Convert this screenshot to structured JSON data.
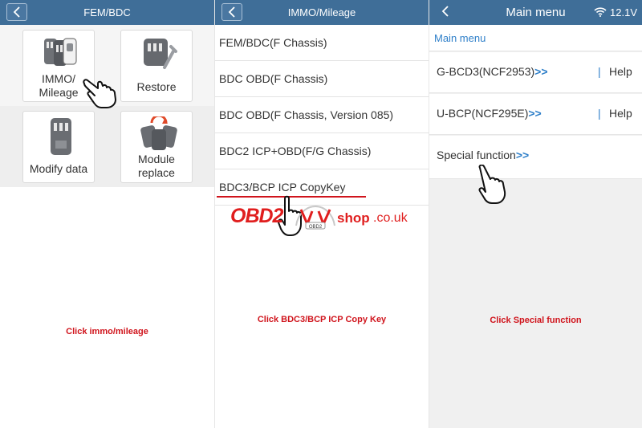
{
  "panel1": {
    "title": "FEM/BDC",
    "tiles": [
      {
        "label_line1": "IMMO/",
        "label_line2": "Mileage"
      },
      {
        "label_line1": "Restore",
        "label_line2": ""
      },
      {
        "label_line1": "Modify data",
        "label_line2": ""
      },
      {
        "label_line1": "Module",
        "label_line2": "replace"
      }
    ],
    "caption": "Click immo/mileage"
  },
  "panel2": {
    "title": "IMMO/Mileage",
    "items": [
      "FEM/BDC(F Chassis)",
      "BDC OBD(F Chassis)",
      "BDC OBD(F Chassis, Version 085)",
      "BDC2 ICP+OBD(F/G Chassis)",
      "BDC3/BCP ICP CopyKey"
    ],
    "caption": "Click BDC3/BCP ICP Copy Key"
  },
  "panel3": {
    "title": "Main menu",
    "voltage": "12.1V",
    "breadcrumb": "Main menu",
    "rows": [
      {
        "label": "G-BCD3(NCF2953)",
        "arrows": ">>",
        "separator": "|",
        "help": "Help"
      },
      {
        "label": "U-BCP(NCF295E)",
        "arrows": ">>",
        "separator": "|",
        "help": "Help"
      },
      {
        "label": "Special function",
        "arrows": ">>",
        "separator": "",
        "help": ""
      }
    ],
    "caption": "Click Special function"
  },
  "watermark": {
    "brand": "OBD2",
    "mark": "OBD2",
    "shop": "shop",
    "domain": ".co.uk"
  },
  "colors": {
    "header": "#3f6e98",
    "accent_blue": "#2e7fc9",
    "caption_red": "#d0141c"
  }
}
